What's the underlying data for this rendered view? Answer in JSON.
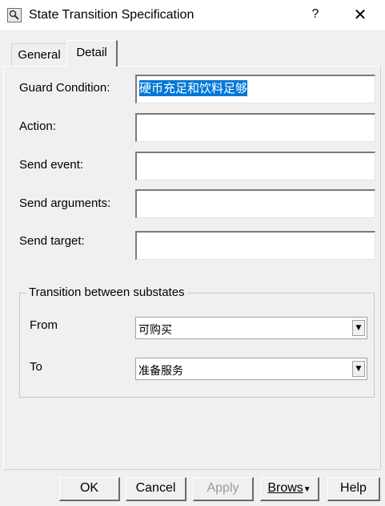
{
  "window": {
    "title": "State Transition Specification",
    "help_glyph": "?",
    "close_glyph": "✕"
  },
  "tabs": [
    {
      "label": "General"
    },
    {
      "label": "Detail"
    }
  ],
  "fields": {
    "guard_condition": {
      "label": "Guard Condition:",
      "value": "硬币充足和饮料足够"
    },
    "action": {
      "label": "Action:",
      "value": ""
    },
    "send_event": {
      "label": "Send event:",
      "value": ""
    },
    "send_arguments": {
      "label": "Send arguments:",
      "value": ""
    },
    "send_target": {
      "label": "Send target:",
      "value": ""
    }
  },
  "substates": {
    "legend": "Transition between substates",
    "from": {
      "label": "From",
      "value": "可购买"
    },
    "to": {
      "label": "To",
      "value": "准备服务"
    }
  },
  "buttons": {
    "ok": "OK",
    "cancel": "Cancel",
    "apply": "Apply",
    "browse": "Brows",
    "help": "Help"
  },
  "colors": {
    "selection": "#0078d7",
    "window_bg": "#f0f0f0"
  }
}
